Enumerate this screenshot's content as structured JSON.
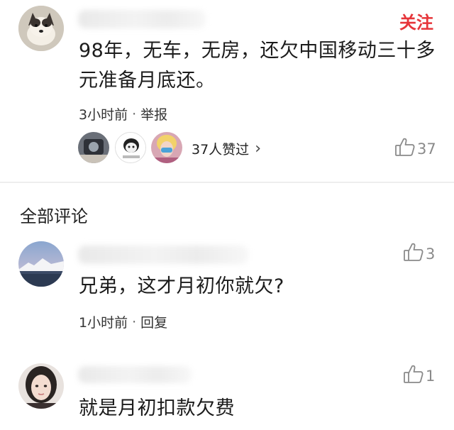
{
  "main_post": {
    "follow_label": "关注",
    "text_line1": "98年，无车，无房，还欠中国移动三十多",
    "text_line2": "元准备月底还。",
    "time": "3小时前",
    "report_label": "举报",
    "likers_text": "37人赞过",
    "likers_chevron": "›",
    "like_count": "37"
  },
  "section_title": "全部评论",
  "comments": [
    {
      "text": "兄弟，这才月初你就欠?",
      "time": "1小时前",
      "reply_label": "回复",
      "like_count": "3"
    },
    {
      "text": "就是月初扣款欠费",
      "like_count": "1"
    }
  ],
  "colors": {
    "follow": "#e6353a",
    "like_icon": "#8a8a8a"
  },
  "icons": [
    "thumbs-up-icon",
    "chevron-right-icon"
  ]
}
